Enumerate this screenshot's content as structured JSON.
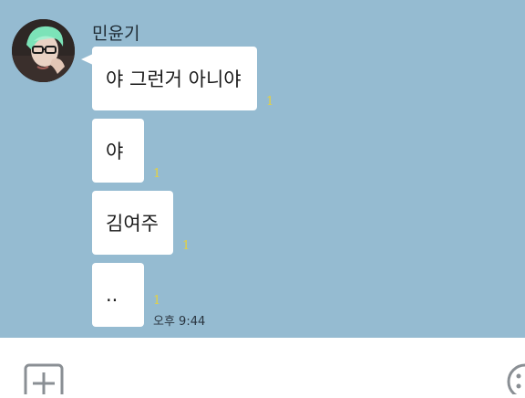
{
  "chat": {
    "background_color": "#95bbd1",
    "sender": {
      "name": "민윤기",
      "avatar_icon": "profile-photo"
    },
    "messages": [
      {
        "text": "야 그런거 아니야",
        "unread": "1"
      },
      {
        "text": "야",
        "unread": "1"
      },
      {
        "text": "김여주",
        "unread": "1"
      },
      {
        "text": "..",
        "unread": "1"
      }
    ],
    "last_time": "오후 9:44",
    "unread_color": "#e8d23a"
  },
  "composer": {
    "attach_icon": "plus-square-icon",
    "emoji_icon": "smiley-icon"
  }
}
